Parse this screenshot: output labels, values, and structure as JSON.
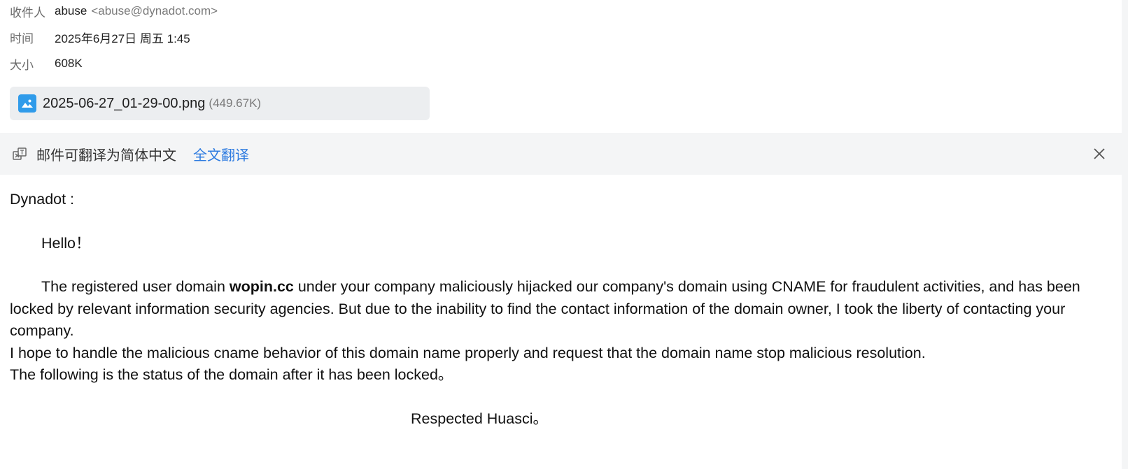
{
  "header": {
    "recipient_label": "收件人",
    "recipient_name": "abuse",
    "recipient_email": "<abuse@dynadot.com>",
    "time_label": "时间",
    "time_value": "2025年6月27日 周五 1:45",
    "size_label": "大小",
    "size_value": "608K"
  },
  "attachment": {
    "filename": "2025-06-27_01-29-00.png",
    "size": "(449.67K)",
    "icon": "image-icon"
  },
  "translate_bar": {
    "notice": "邮件可翻译为简体中文",
    "action": "全文翻译",
    "icon": "translate-icon",
    "close_icon": "close-icon"
  },
  "message": {
    "greeting": "Dynadot :",
    "hello": "Hello！",
    "para1_before": "The registered user domain ",
    "domain": "wopin.cc",
    "para1_after": " under your company maliciously hijacked our company's domain using CNAME for fraudulent activities, and has been locked by relevant information security agencies. But due to the inability to find the contact information of the domain owner, I took the liberty of contacting your company.",
    "line2": "I hope to handle the malicious cname behavior of this domain name properly and request that the domain name stop malicious resolution.",
    "line3": "The following is the status of the domain after it has been locked。",
    "signature": "Respected Huasci。"
  },
  "colors": {
    "link": "#2d7be0",
    "icon_blue": "#2f9bea",
    "bar_bg": "#f4f5f6",
    "attachment_bg": "#eceef0"
  }
}
